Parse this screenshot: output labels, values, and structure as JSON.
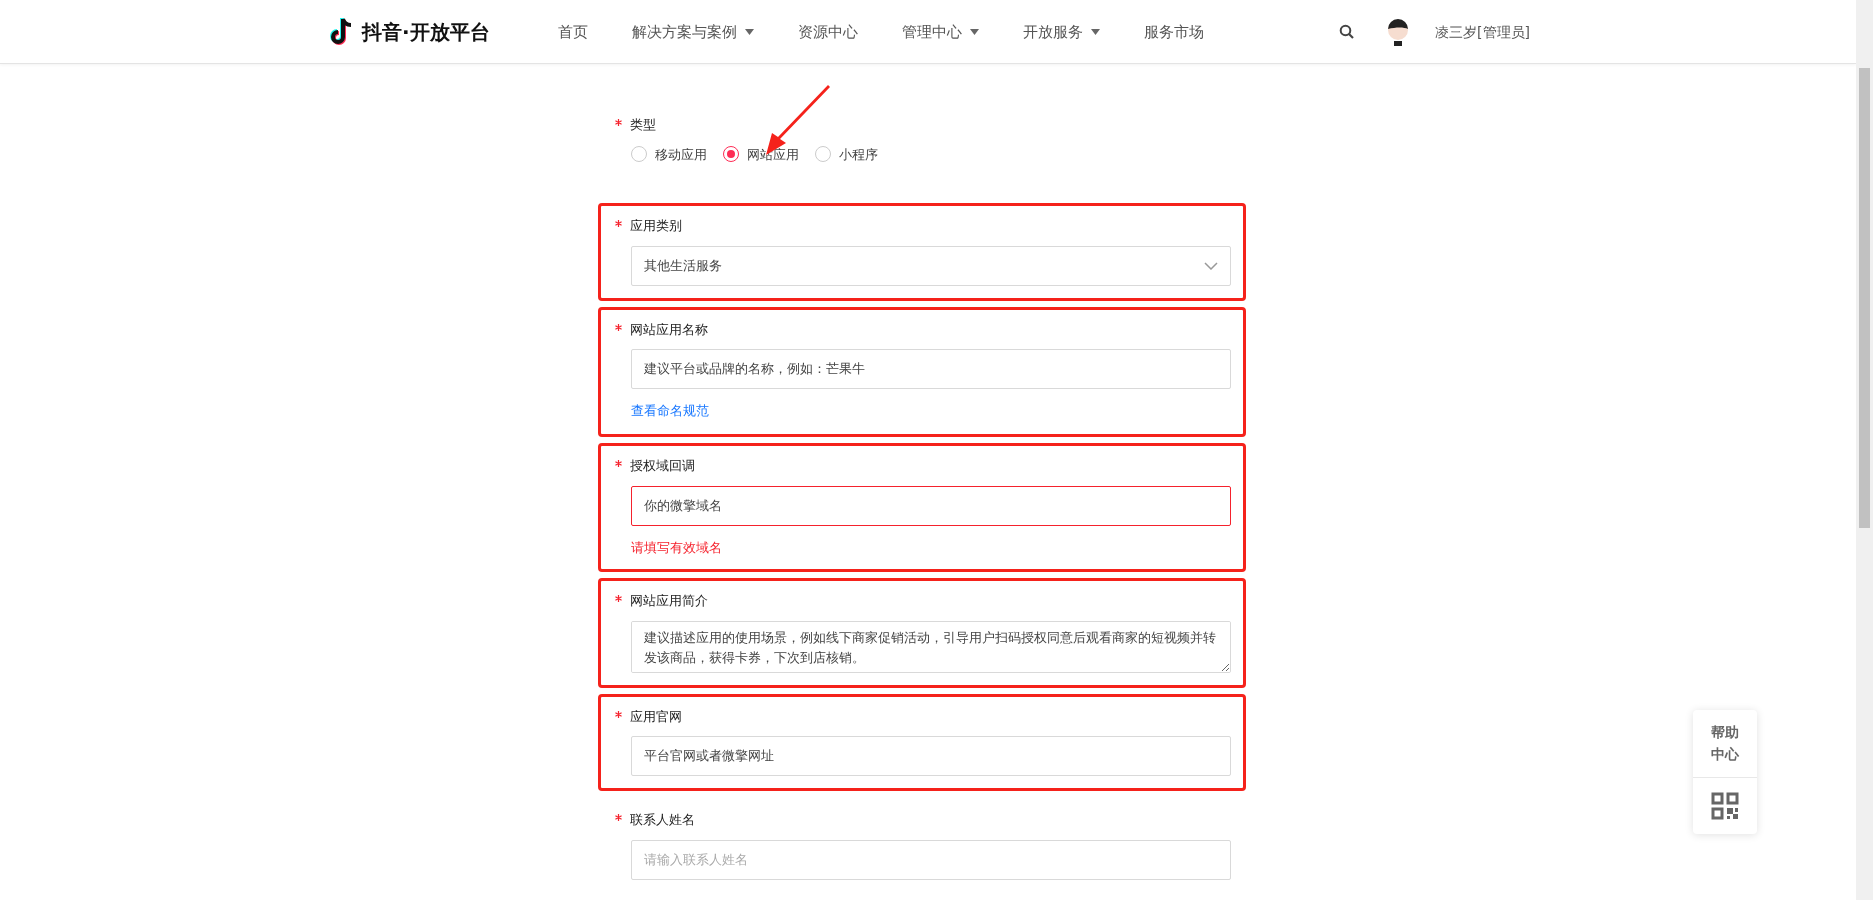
{
  "header": {
    "logo_text": "抖音·开放平台",
    "nav": [
      {
        "label": "首页",
        "dropdown": false
      },
      {
        "label": "解决方案与案例",
        "dropdown": true
      },
      {
        "label": "资源中心",
        "dropdown": false
      },
      {
        "label": "管理中心",
        "dropdown": true
      },
      {
        "label": "开放服务",
        "dropdown": true
      },
      {
        "label": "服务市场",
        "dropdown": false
      }
    ],
    "user": "凌三岁[管理员]"
  },
  "form": [
    {
      "kind": "radio",
      "label": "类型",
      "required": true,
      "highlighted": false,
      "options": [
        {
          "label": "移动应用",
          "selected": false
        },
        {
          "label": "网站应用",
          "selected": true
        },
        {
          "label": "小程序",
          "selected": false
        }
      ]
    },
    {
      "kind": "select",
      "label": "应用类别",
      "required": true,
      "highlighted": true,
      "value": "其他生活服务"
    },
    {
      "kind": "input",
      "label": "网站应用名称",
      "required": true,
      "highlighted": true,
      "value": "建议平台或品牌的名称，例如：芒果牛",
      "link": "查看命名规范"
    },
    {
      "kind": "input",
      "label": "授权域回调",
      "required": true,
      "highlighted": true,
      "value": "你的微擎域名",
      "error": "请填写有效域名"
    },
    {
      "kind": "textarea",
      "label": "网站应用简介",
      "required": true,
      "highlighted": true,
      "value": "建议描述应用的使用场景，例如线下商家促销活动，引导用户扫码授权同意后观看商家的短视频并转发该商品，获得卡券，下次到店核销。"
    },
    {
      "kind": "input",
      "label": "应用官网",
      "required": true,
      "highlighted": true,
      "value": "平台官网或者微擎网址"
    },
    {
      "kind": "input",
      "label": "联系人姓名",
      "required": true,
      "highlighted": false,
      "placeholder": "请输入联系人姓名"
    }
  ],
  "help_widget": {
    "label": "帮助中心"
  }
}
